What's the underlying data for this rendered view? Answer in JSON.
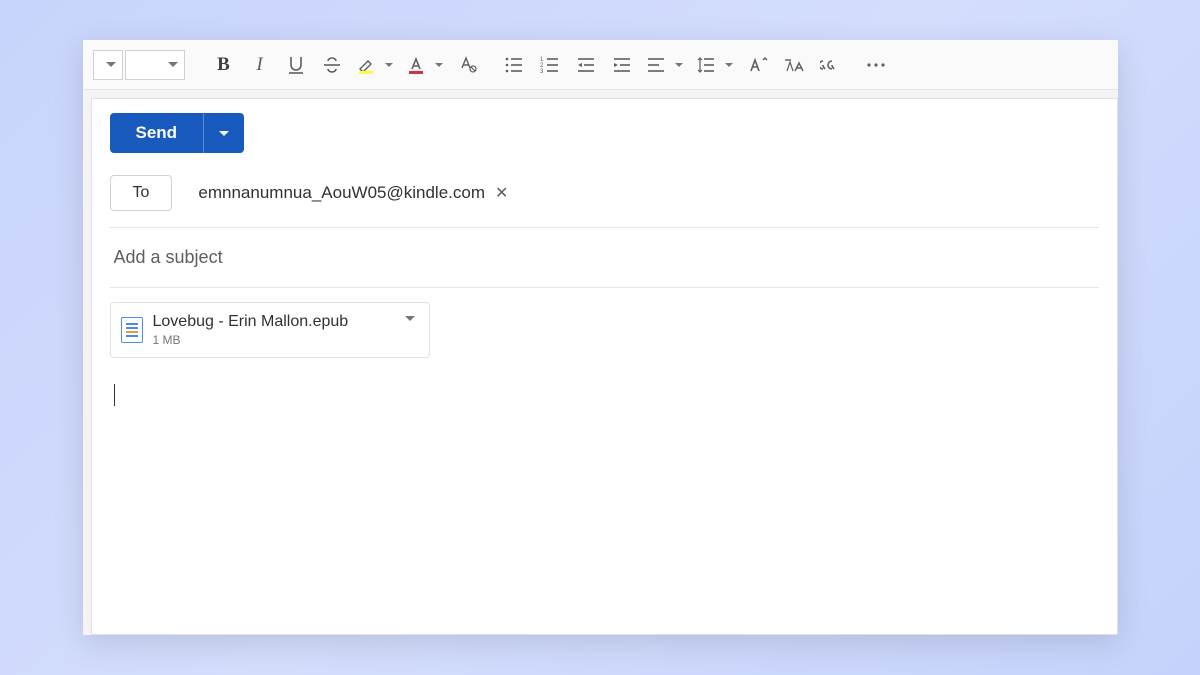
{
  "toolbar": {
    "font_family": "",
    "font_size": ""
  },
  "compose": {
    "send_label": "Send",
    "to_button_label": "To",
    "recipient": "emnnanumnua_AouW05@kindle.com",
    "subject_placeholder": "Add a subject",
    "subject_value": "",
    "attachment": {
      "name": "Lovebug - Erin Mallon.epub",
      "size": "1 MB"
    },
    "body": ""
  }
}
